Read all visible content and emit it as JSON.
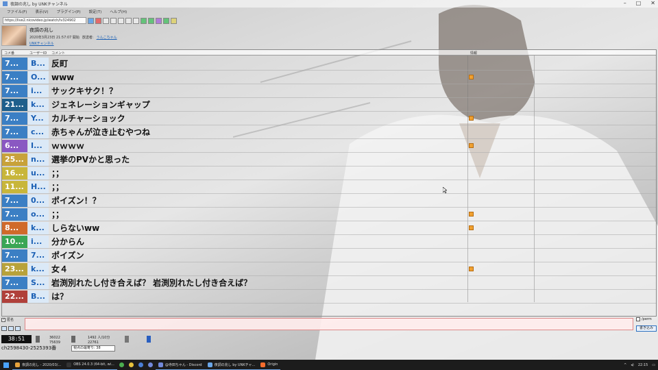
{
  "window": {
    "title": "夜調の兆し by UNKチャンネル"
  },
  "menu": [
    "ファイル(F)",
    "表示(V)",
    "プラグイン(P)",
    "設定(T)",
    "ヘルプ(H)"
  ],
  "url": {
    "value": "https://live2.nicovideo.jp/watch/lv324902"
  },
  "broadcast": {
    "title": "夜調の兆し",
    "date": "2020年3月23日 21:57:07 開始",
    "host_label": "放送者:",
    "host": "うんこちゃん",
    "channel": "UNKチャンネル"
  },
  "table": {
    "headers": {
      "num": "コメ番",
      "user": "ユーザーID",
      "comment": "コメント",
      "info": "情報"
    },
    "rows": [
      {
        "num": "7...",
        "user": "B...",
        "comment": "反町",
        "color": "#3b7fc4",
        "badge": false
      },
      {
        "num": "7...",
        "user": "O...",
        "comment": "www",
        "color": "#3b7fc4",
        "badge": true
      },
      {
        "num": "7...",
        "user": "i...",
        "comment": "サックキサク！？",
        "color": "#3b7fc4",
        "badge": false
      },
      {
        "num": "21...",
        "user": "k...",
        "comment": "ジェネレーションギャップ",
        "color": "#1e5f8c",
        "badge": false
      },
      {
        "num": "7...",
        "user": "Y...",
        "comment": "カルチャーショック",
        "color": "#3b7fc4",
        "badge": true
      },
      {
        "num": "7...",
        "user": "c...",
        "comment": "赤ちゃんが泣き止むやつね",
        "color": "#3b7fc4",
        "badge": false
      },
      {
        "num": "6...",
        "user": "I...",
        "comment": "ｗｗｗｗ",
        "color": "#8a58c2",
        "badge": true
      },
      {
        "num": "25...",
        "user": "n...",
        "comment": "選挙のPVかと思った",
        "color": "#c8a23a",
        "badge": false
      },
      {
        "num": "16...",
        "user": "u...",
        "comment": "；；",
        "color": "#c8b63a",
        "badge": false
      },
      {
        "num": "11...",
        "user": "H...",
        "comment": "；；",
        "color": "#c8b63a",
        "badge": false
      },
      {
        "num": "7...",
        "user": "0...",
        "comment": "ポイズン！？",
        "color": "#3b7fc4",
        "badge": false
      },
      {
        "num": "7...",
        "user": "o...",
        "comment": "；；",
        "color": "#3b7fc4",
        "badge": true
      },
      {
        "num": "8...",
        "user": "k...",
        "comment": "しらないww",
        "color": "#d06a2a",
        "badge": true
      },
      {
        "num": "10...",
        "user": "i...",
        "comment": "分からん",
        "color": "#3aa655",
        "badge": false
      },
      {
        "num": "7...",
        "user": "7...",
        "comment": "ポイズン",
        "color": "#3b7fc4",
        "badge": false
      },
      {
        "num": "23...",
        "user": "k...",
        "comment": "女４",
        "color": "#b8a23a",
        "badge": true
      },
      {
        "num": "7...",
        "user": "S...",
        "comment": "岩渕別れたし付き合えば？ 岩渕別れたし付き合えば？",
        "color": "#3b7fc4",
        "badge": false
      },
      {
        "num": "22...",
        "user": "B...",
        "comment": "は？",
        "color": "#b0403a",
        "badge": false
      }
    ]
  },
  "comment_box": {
    "checkbox_label": "匿名",
    "perm_label": "/perm",
    "send_label": "書き込み"
  },
  "status": {
    "time": "38:51",
    "viewers": "36022",
    "comments": "75639",
    "active": "1492 人/10分",
    "points": "22761",
    "channel_id": "ch2598430-2525393番",
    "sel_value": "視点の最寄り: 38"
  },
  "taskbar": {
    "items": [
      {
        "label": "夜調の兆し - 2020/03/...",
        "color": "#e6a23c"
      },
      {
        "label": "OBS 24.0.3 (64-bit, wi...",
        "color": "#333333"
      },
      {
        "label": "@寺田ちゃん - Discord",
        "color": "#7289da"
      },
      {
        "label": "夜調の兆し by UNKチャ...",
        "color": "#6aa6e8"
      },
      {
        "label": "Origin",
        "color": "#f56c2d"
      }
    ],
    "clock": "22:15"
  }
}
